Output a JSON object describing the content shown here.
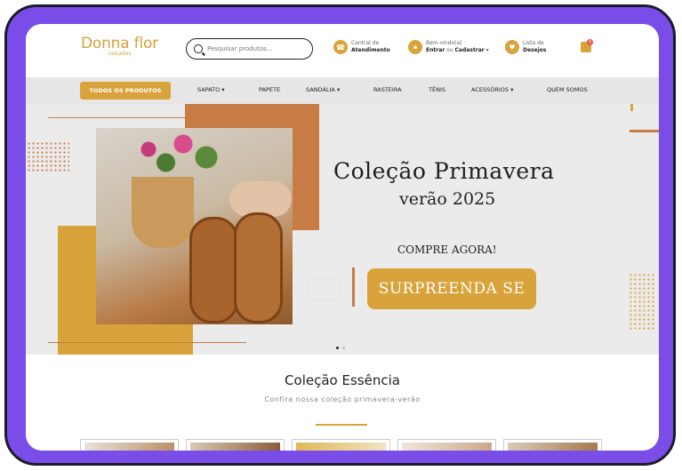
{
  "header": {
    "logo_name": "Donna flor",
    "logo_sub": "calçados",
    "search_placeholder": "Pesquisar produtos...",
    "support_line1": "Central de",
    "support_line2": "Atendimento",
    "account_line1": "Bem-vindo(a)",
    "account_enter": "Entrar",
    "account_or": " ou ",
    "account_register": "Cadastrar",
    "wishlist_line1": "Lista de",
    "wishlist_line2": "Desejos",
    "cart_count": "0"
  },
  "nav": {
    "all_products": "TODOS OS PRODUTOS",
    "items": [
      {
        "label": "SAPATO",
        "dropdown": true
      },
      {
        "label": "PAPETE",
        "dropdown": false
      },
      {
        "label": "SANDÁLIA",
        "dropdown": true
      },
      {
        "label": "RASTEIRA",
        "dropdown": false
      },
      {
        "label": "TÊNIS",
        "dropdown": false
      },
      {
        "label": "ACESSÓRIOS",
        "dropdown": true
      },
      {
        "label": "QUEM SOMOS",
        "dropdown": false
      }
    ]
  },
  "banner": {
    "title": "Coleção Primavera",
    "subtitle": "verão 2025",
    "compre": "COMPRE AGORA!",
    "cta": "SURPREENDA SE",
    "slides": 2,
    "active_slide": 1
  },
  "section": {
    "title": "Coleção Essência",
    "subtitle": "Confira nossa coleção primavera-verão"
  },
  "colors": {
    "gold": "#d9a33b",
    "terracotta": "#c77b45",
    "frame": "#7b4de8"
  },
  "icons": [
    "search-icon",
    "headset-icon",
    "lock-icon",
    "heart-icon",
    "cart-icon",
    "chevron-down-icon"
  ]
}
